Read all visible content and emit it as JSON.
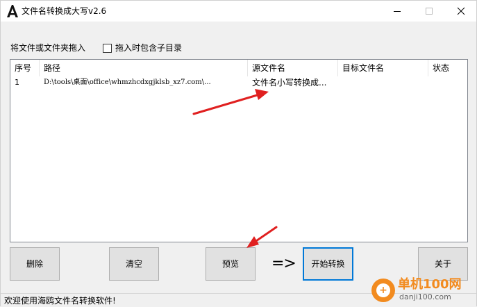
{
  "window": {
    "title": "文件名转换成大写v2.6"
  },
  "drop_area": {
    "label": "将文件或文件夹拖入",
    "include_subdirs_label": "拖入时包含子目录",
    "include_subdirs_checked": false
  },
  "table": {
    "columns": [
      "序号",
      "路径",
      "源文件名",
      "目标文件名",
      "状态"
    ],
    "rows": [
      [
        "1",
        "D:\\tools\\桌面\\office\\whmzhcdxgjklsb_xz7.com\\...",
        "文件名小写转换成...",
        "",
        ""
      ]
    ]
  },
  "buttons": {
    "delete": "删除",
    "clear": "清空",
    "preview": "预览",
    "arrow": "=>",
    "start": "开始转换",
    "about": "关于"
  },
  "statusbar": {
    "text": "欢迎使用海鸥文件名转换软件!"
  },
  "watermark": {
    "title": "单机100网",
    "url": "danji100.com"
  },
  "colors": {
    "primary_border": "#0078d7",
    "annotation_arrow": "#e02020",
    "watermark_orange": "#f28b1f"
  }
}
